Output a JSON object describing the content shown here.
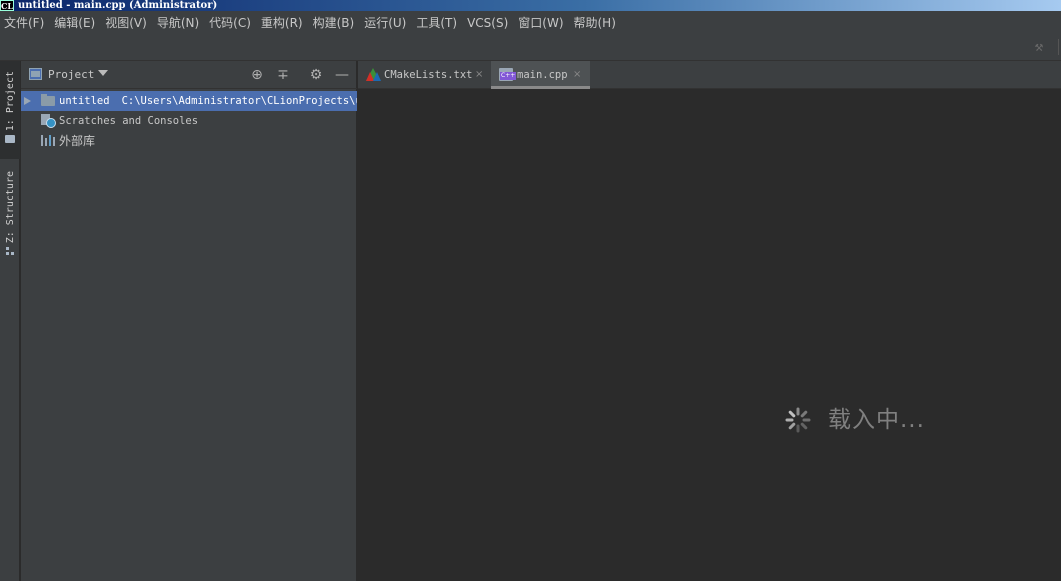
{
  "window": {
    "app_icon_text": "CL",
    "title": "untitled - main.cpp (Administrator)"
  },
  "menu": [
    "文件(F)",
    "编辑(E)",
    "视图(V)",
    "导航(N)",
    "代码(C)",
    "重构(R)",
    "构建(B)",
    "运行(U)",
    "工具(T)",
    "VCS(S)",
    "窗口(W)",
    "帮助(H)"
  ],
  "toolbar": {
    "icon": "hammer-icon"
  },
  "tool_strip": {
    "project_tab": "1: Project",
    "structure_tab": "Z: Structure"
  },
  "project_panel": {
    "view_label": "Project",
    "header_icons": [
      "locate-icon",
      "collapse-all-icon",
      "settings-icon",
      "hide-icon"
    ],
    "tree": {
      "root_name": "untitled",
      "root_path": "C:\\Users\\Administrator\\CLionProjects\\un",
      "scratches": "Scratches and Consoles",
      "external_libs": "外部库"
    }
  },
  "tabs": [
    {
      "label": "CMakeLists.txt",
      "icon": "cmake-icon",
      "active": false
    },
    {
      "label": "main.cpp",
      "icon": "cpp-file-icon",
      "active": true
    }
  ],
  "tab_close_symbol": "×",
  "editor": {
    "loading_text": "载入中..."
  },
  "colors": {
    "selection": "#4b6eaf",
    "panel": "#3c3f41",
    "editor_bg": "#2b2b2b"
  }
}
